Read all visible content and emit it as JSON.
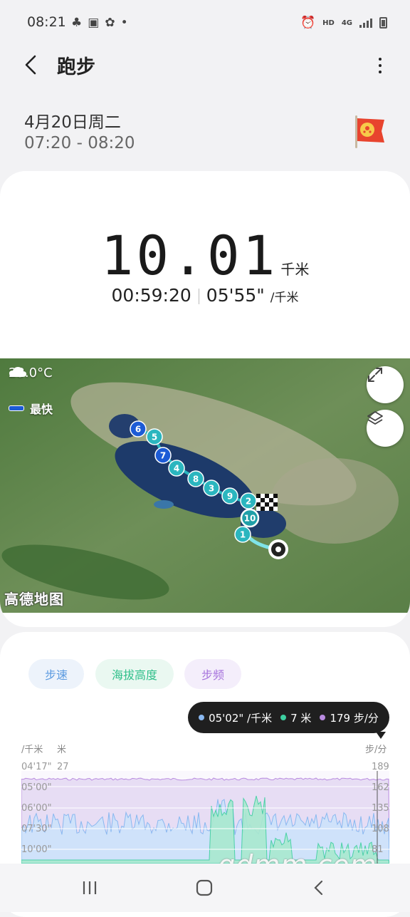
{
  "status": {
    "time": "08:21",
    "hd": "HD",
    "network": "4G"
  },
  "app": {
    "title": "跑步"
  },
  "workout": {
    "date": "4月20日周二",
    "time_range": "07:20 - 08:20",
    "distance": "10.01",
    "distance_unit": "千米",
    "duration": "00:59:20",
    "avg_pace": "05'55\"",
    "pace_unit": "/千米"
  },
  "map": {
    "temperature": "23.0°C",
    "legend_fastest": "最快",
    "provider": "高德地图",
    "km_markers": [
      "1",
      "2",
      "3",
      "4",
      "5",
      "6",
      "7",
      "8",
      "9",
      "10"
    ]
  },
  "chart": {
    "tabs": [
      "步速",
      "海拔高度",
      "步频"
    ],
    "tooltip": {
      "pace": "05'02\" /千米",
      "altitude": "7 米",
      "cadence": "179 步/分"
    },
    "axis_units": {
      "pace": "/千米",
      "altitude": "米",
      "cadence": "步/分"
    },
    "pace_ticks": [
      "04'17\"",
      "05'00\"",
      "06'00\"",
      "07'30\"",
      "10'00\""
    ],
    "altitude_ticks": [
      "27"
    ],
    "cadence_ticks": [
      "189",
      "162",
      "135",
      "108",
      "81"
    ],
    "colors": {
      "pace": "#8ab8f0",
      "altitude": "#3dcfa0",
      "cadence": "#b98be0"
    }
  },
  "watermark": "gdmm.com"
}
